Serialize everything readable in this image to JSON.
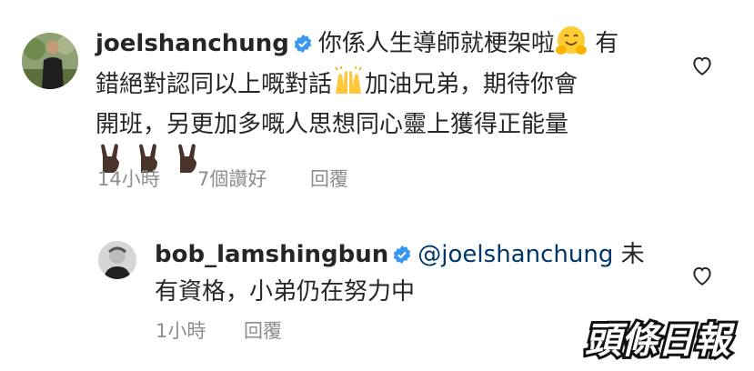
{
  "comments": [
    {
      "username": "joelshanchung",
      "text_part1": "你係人生導師就梗架啦",
      "text_part2": " 有",
      "text_line2a": "錯絕對認同以上嘅對話",
      "text_line2b": "加油兄弟，期待你會",
      "text_line3": "開班，另更加多嘅人思想同心靈上獲得正能量",
      "emojis": [
        "hugging-face",
        "raising-hands",
        "sign-of-horns",
        "sign-of-horns",
        "sign-of-horns"
      ],
      "time": "14小時",
      "likes": "7個讚好",
      "reply_label": "回覆"
    },
    {
      "username": "bob_lamshingbun",
      "mention": "@joelshanchung",
      "text_part1": " 未",
      "text_line2": "有資格，小弟仍在努力中",
      "time": "1小時",
      "reply_label": "回覆"
    }
  ],
  "watermark": "頭條日報",
  "colors": {
    "verified": "#3897f0",
    "mention": "#00376b",
    "meta": "#8e8e8e"
  }
}
